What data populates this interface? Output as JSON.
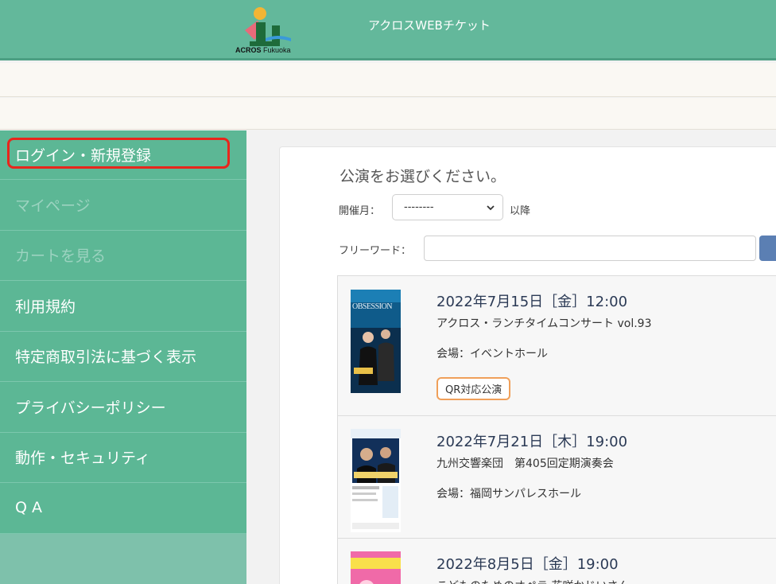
{
  "header": {
    "logo_bold": "ACROS",
    "logo_light": " Fukuoka",
    "site_title": "アクロスWEBチケット"
  },
  "sidebar": {
    "items": [
      {
        "label": "ログイン・新規登録"
      },
      {
        "label": "マイページ"
      },
      {
        "label": "カートを見る"
      },
      {
        "label": "利用規約"
      },
      {
        "label": "特定商取引法に基づく表示"
      },
      {
        "label": "プライバシーポリシー"
      },
      {
        "label": "動作・セキュリティ"
      },
      {
        "label": "Q A"
      }
    ]
  },
  "main": {
    "title": "公演をお選びください。",
    "month_label": "開催月：",
    "month_value": "--------",
    "month_suffix": "以降",
    "freeword_label": "フリーワード：",
    "freeword_value": ""
  },
  "events": [
    {
      "date": "2022年7月15日［金］12:00",
      "title": "アクロス・ランチタイムコンサート vol.93",
      "venue": "会場：イベントホール",
      "badge": "QR対応公演",
      "poster_text": "OBSESSION"
    },
    {
      "date": "2022年7月21日［木］19:00",
      "title": "九州交響楽団　第405回定期演奏会",
      "venue": "会場：福岡サンパレスホール"
    },
    {
      "date": "2022年8月5日［金］19:00",
      "title": "こどものためのオペラ 花咲かじいさん"
    }
  ],
  "colors": {
    "header_bg": "#63b89b",
    "sidebar_bg": "#5cb795",
    "highlight_border": "#e8261c",
    "badge_border": "#f0a05a",
    "search_button": "#5b7fb3"
  }
}
